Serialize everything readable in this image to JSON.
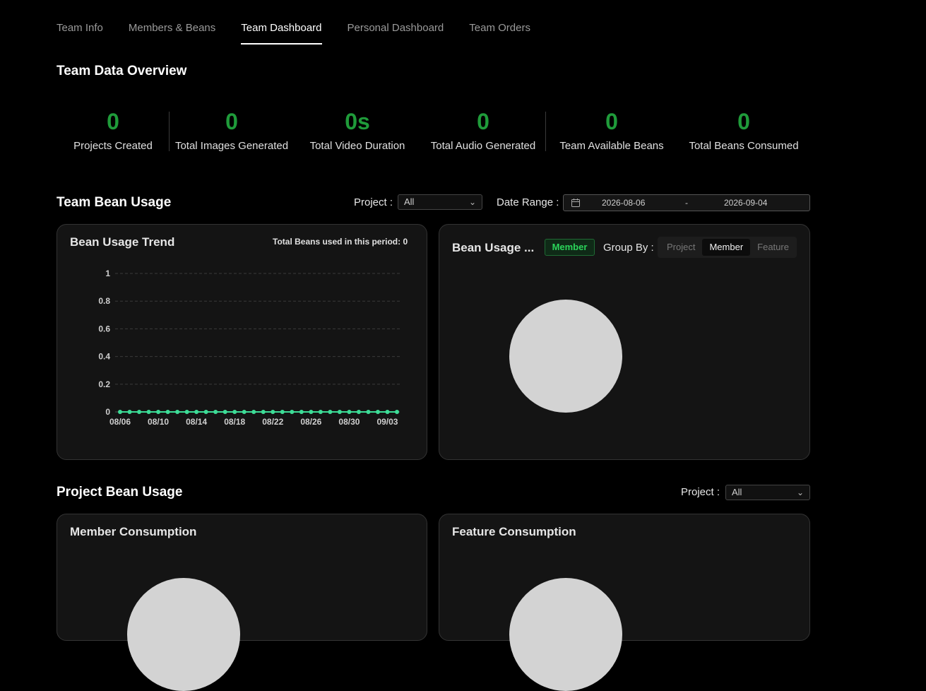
{
  "tabs": [
    "Team Info",
    "Members & Beans",
    "Team Dashboard",
    "Personal Dashboard",
    "Team Orders"
  ],
  "active_tab": "Team Dashboard",
  "overview": {
    "title": "Team Data Overview",
    "stats": [
      {
        "value": "0",
        "label": "Projects Created"
      },
      {
        "value": "0",
        "label": "Total Images Generated"
      },
      {
        "value": "0s",
        "label": "Total Video Duration"
      },
      {
        "value": "0",
        "label": "Total Audio Generated"
      },
      {
        "value": "0",
        "label": "Team Available Beans"
      },
      {
        "value": "0",
        "label": "Total Beans Consumed"
      }
    ]
  },
  "team_usage": {
    "title": "Team Bean Usage",
    "project_label": "Project :",
    "project_value": "All",
    "date_label": "Date Range :",
    "date_start": "2026-08-06",
    "date_sep": "-",
    "date_end": "2026-09-04"
  },
  "trend_card": {
    "title": "Bean Usage Trend",
    "total_label": "Total Beans used in this period: 0"
  },
  "breakdown_card": {
    "title": "Bean Usage ...",
    "badge": "Member",
    "group_by_label": "Group By :",
    "group_options": [
      "Project",
      "Member",
      "Feature"
    ],
    "group_selected": "Member"
  },
  "project_usage": {
    "title": "Project Bean Usage",
    "project_label": "Project :",
    "project_value": "All"
  },
  "member_card": {
    "title": "Member Consumption"
  },
  "feature_card": {
    "title": "Feature Consumption"
  },
  "colors": {
    "accent": "#1f9b3a",
    "line": "#3ddc97",
    "pie": "#d3d3d3"
  },
  "chart_data": {
    "type": "line",
    "title": "",
    "x": [
      "08/06",
      "08/07",
      "08/08",
      "08/09",
      "08/10",
      "08/11",
      "08/12",
      "08/13",
      "08/14",
      "08/15",
      "08/16",
      "08/17",
      "08/18",
      "08/19",
      "08/20",
      "08/21",
      "08/22",
      "08/23",
      "08/24",
      "08/25",
      "08/26",
      "08/27",
      "08/28",
      "08/29",
      "08/30",
      "08/31",
      "09/01",
      "09/02",
      "09/03",
      "09/04"
    ],
    "x_ticks": [
      "08/06",
      "08/10",
      "08/14",
      "08/18",
      "08/22",
      "08/26",
      "08/30",
      "09/03"
    ],
    "y_ticks": [
      0,
      0.2,
      0.4,
      0.6,
      0.8,
      1
    ],
    "ylim": [
      0,
      1
    ],
    "series": [
      {
        "values": [
          0,
          0,
          0,
          0,
          0,
          0,
          0,
          0,
          0,
          0,
          0,
          0,
          0,
          0,
          0,
          0,
          0,
          0,
          0,
          0,
          0,
          0,
          0,
          0,
          0,
          0,
          0,
          0,
          0,
          0
        ]
      }
    ],
    "grid": true
  }
}
